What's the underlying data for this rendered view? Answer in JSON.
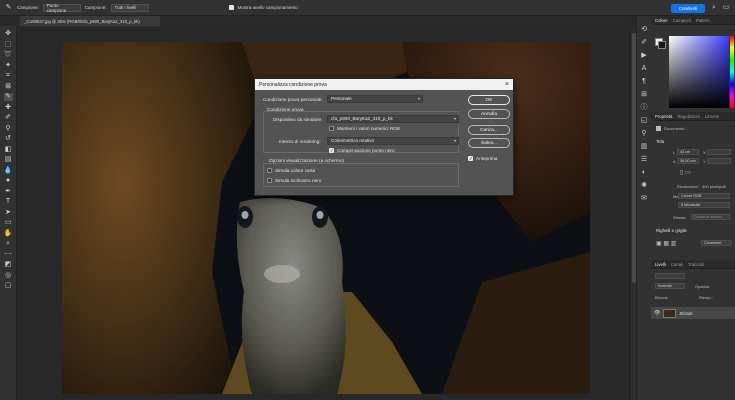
{
  "options_bar": {
    "sample_label": "Campione:",
    "sample_value": "Punto campione",
    "sample2_label": "Campione:",
    "sample2_value": "Tutti i livelli",
    "ring_label": "Mostra anello campionamento",
    "share_button": "Condividi"
  },
  "document": {
    "tab_label": "_CU80537.jpg @ 25% (RGB/8/cfa_p900_BaryKa2_310_p_bk)"
  },
  "dialog": {
    "title": "Personalizza condizione prova",
    "custom_condition_label": "Condizione prova personale:",
    "custom_condition_value": "Personale",
    "proof_condition_heading": "Condizione prova",
    "device_label": "Dispositivo da simulare:",
    "device_value": "cfa_p900_BaryKa2_310_p_bk",
    "preserve_label": "Mantieni i valori numerici RGB",
    "rendering_label": "Intento di rendering:",
    "rendering_value": "Colorimetrico relativo",
    "bpc_label": "Compensazione punto nero",
    "display_options_heading": "Opzioni visualizzazione (a schermo)",
    "paper_label": "Simula colore carta",
    "ink_label": "Simula inchiostro nero",
    "ok_button": "OK",
    "cancel_button": "Annulla",
    "load_button": "Carica...",
    "save_button": "Salva...",
    "preview_label": "Anteprima",
    "checks": {
      "preserve": false,
      "bpc": true,
      "paper": false,
      "ink": false,
      "preview": true
    }
  },
  "panels": {
    "color_tabs": [
      "Colore",
      "Campioni",
      "Pattern"
    ],
    "props_tabs": [
      "Proprietà",
      "Regolazioni",
      "Librerie"
    ],
    "doc_label": "Documento",
    "canvas_heading": "Tela",
    "width_value": "43 cm",
    "height_value": "36,00 cm",
    "x_label": "X",
    "y_label": "Y",
    "w_label": "L",
    "h_label": "A",
    "resolution_label": "Risoluzione:",
    "resolution_value": "300 pixel/poll.",
    "mode_label": "Metodo:",
    "mode_value": "Colore RGB",
    "depth_value": "8 bit/canale",
    "bg_label": "Sfondo",
    "bg_value": "Colore di sfondo",
    "guides_heading": "Righelli e griglie",
    "guides_value": "Centimetri",
    "layers_tabs": [
      "Livelli",
      "Canali",
      "Tracciati"
    ],
    "kind_label": "Normale",
    "opacity_label": "Opacità:",
    "lock_label": "Blocca:",
    "fill_label": "Riemp.:",
    "layer_name": "Sfondo"
  },
  "colors": {
    "accent": "#1473e6",
    "dialog_bg": "#535353",
    "panel_bg": "#323232"
  }
}
